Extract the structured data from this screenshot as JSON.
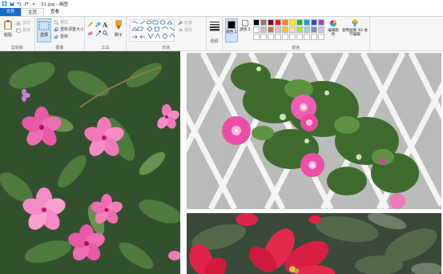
{
  "window": {
    "title": "32.jpg - 画图",
    "quick_access": [
      "save-icon",
      "undo-icon",
      "redo-icon",
      "dropdown-icon"
    ]
  },
  "tabs": [
    {
      "label": "文件"
    },
    {
      "label": "主页"
    },
    {
      "label": "查看"
    }
  ],
  "ribbon": {
    "clipboard": {
      "paste": "粘贴",
      "cut": "剪切",
      "copy": "复制",
      "label": "剪贴板"
    },
    "image": {
      "select": "选择",
      "crop": "裁剪",
      "resize": "重新调整大小",
      "rotate": "旋转",
      "label": "图像"
    },
    "tools": {
      "brushes": "刷子",
      "label": "工具"
    },
    "shapes": {
      "outline": "轮廓",
      "fill": "填充",
      "label": "形状"
    },
    "size": {
      "label": "粗细"
    },
    "colors": {
      "color1": "颜色 1",
      "color2": "颜色 2",
      "edit": "编辑颜色",
      "paint3d": "使用画图 3D 进行编辑",
      "label": "颜色",
      "swatches": [
        "#000000",
        "#7f7f7f",
        "#880015",
        "#ed1c24",
        "#ff7f27",
        "#fff200",
        "#22b14c",
        "#00a2e8",
        "#3f48cc",
        "#a349a4",
        "#ffffff",
        "#c3c3c3",
        "#b97a57",
        "#ffaec9",
        "#ffc90e",
        "#efe4b0",
        "#b5e61d",
        "#99d9ea",
        "#7092be",
        "#c8bfe7",
        "#ffffff",
        "#ffffff",
        "#ffffff",
        "#ffffff",
        "#ffffff",
        "#ffffff",
        "#ffffff",
        "#ffffff",
        "#ffffff",
        "#ffffff"
      ]
    }
  }
}
